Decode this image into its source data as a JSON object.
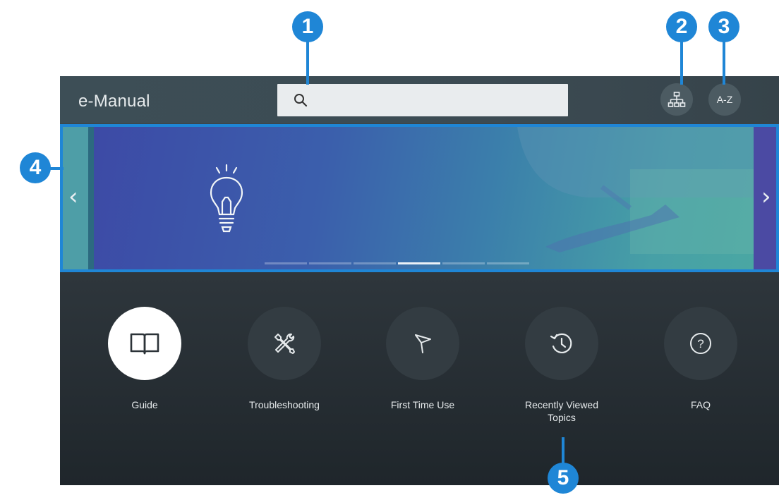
{
  "app": {
    "title": "e-Manual"
  },
  "search": {
    "placeholder": ""
  },
  "header": {
    "sitemap_icon": "sitemap-icon",
    "az_label": "A-Z"
  },
  "banner": {
    "icon": "lightbulb-icon",
    "prev_icon": "chevron-left-icon",
    "next_icon": "chevron-right-icon",
    "page_count": 6,
    "active_page": 4
  },
  "menu": [
    {
      "label": "Guide",
      "icon": "book-icon",
      "selected": true
    },
    {
      "label": "Troubleshooting",
      "icon": "tools-icon",
      "selected": false
    },
    {
      "label": "First Time Use",
      "icon": "flag-icon",
      "selected": false
    },
    {
      "label": "Recently Viewed Topics",
      "icon": "history-icon",
      "selected": false
    },
    {
      "label": "FAQ",
      "icon": "question-icon",
      "selected": false
    }
  ],
  "callouts": [
    "1",
    "2",
    "3",
    "4",
    "5"
  ],
  "colors": {
    "callout": "#1f86d6",
    "highlight_border": "#1f86d6"
  }
}
